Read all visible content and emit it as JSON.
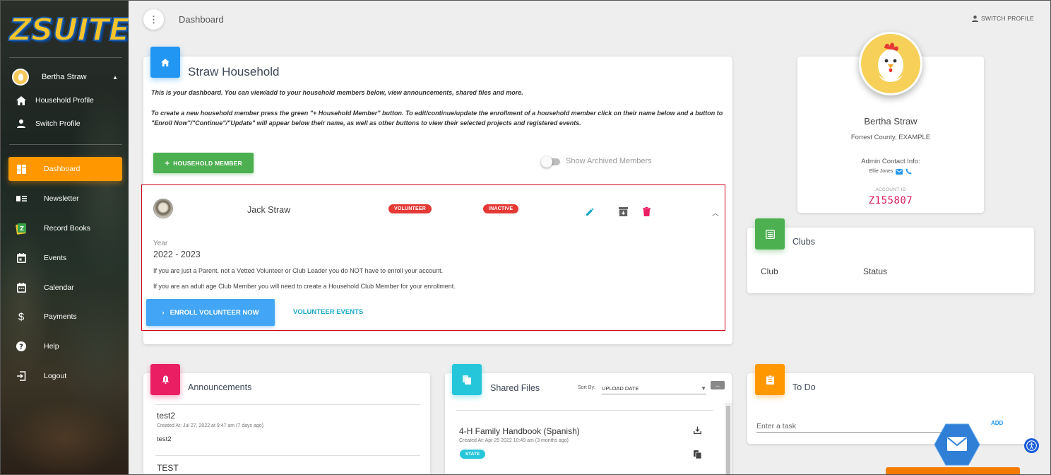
{
  "app": {
    "logo_text": "ZSUITE"
  },
  "sidebar": {
    "user_name": "Bertha Straw",
    "sub_items": [
      {
        "label": "Household Profile",
        "icon": "home-icon"
      },
      {
        "label": "Switch Profile",
        "icon": "person-icon"
      }
    ],
    "items": [
      {
        "label": "Dashboard",
        "icon": "dashboard-icon",
        "active": true
      },
      {
        "label": "Newsletter",
        "icon": "newsletter-icon"
      },
      {
        "label": "Record Books",
        "icon": "record-books-icon"
      },
      {
        "label": "Events",
        "icon": "events-icon"
      },
      {
        "label": "Calendar",
        "icon": "calendar-icon"
      },
      {
        "label": "Payments",
        "icon": "dollar-icon"
      },
      {
        "label": "Help",
        "icon": "help-icon"
      },
      {
        "label": "Logout",
        "icon": "logout-icon"
      }
    ]
  },
  "header": {
    "breadcrumb": "Dashboard",
    "switch_profile": "SWITCH PROFILE"
  },
  "household": {
    "title": "Straw Household",
    "intro1": "This is your dashboard. You can view/add to your household members below, view announcements, shared files and more.",
    "intro2": "To create a new household member press the green \"+ Household Member\" button. To edit/continue/update the enrollment of a household member click on their name below and a button to \"Enroll Now\"/\"Continue\"/\"Update\" will appear below their name, as well as other buttons to view their selected projects and registered events.",
    "add_member_label": "HOUSEHOLD MEMBER",
    "show_archived_label": "Show Archived Members",
    "member": {
      "name": "Jack Straw",
      "role_badge": "VOLUNTEER",
      "status_badge": "INACTIVE",
      "year_label": "Year",
      "year_value": "2022 - 2023",
      "note1": "If you are just a Parent, not a Vetted Volunteer or Club Leader you do NOT have to enroll your account.",
      "note2": "If you are an adult age Club Member you will need to create a Household Club Member for your enrollment.",
      "enroll_label": "ENROLL VOLUNTEER NOW",
      "events_label": "VOLUNTEER EVENTS"
    }
  },
  "profile": {
    "name": "Bertha Straw",
    "county": "Forrest County, EXAMPLE",
    "admin_label": "Admin Contact Info:",
    "admin_name": "Ellie Jones",
    "account_id_label": "ACCOUNT ID",
    "account_id": "Z155807"
  },
  "clubs": {
    "title": "Clubs",
    "col_club": "Club",
    "col_status": "Status"
  },
  "announcements": {
    "title": "Announcements",
    "items": [
      {
        "title": "test2",
        "meta": "Created At: Jul 27, 2022 at 9:47 am (7 days ago)",
        "body": "test2"
      },
      {
        "title": "TEST"
      }
    ]
  },
  "shared_files": {
    "title": "Shared Files",
    "sort_label": "Sort By:",
    "sort_value": "UPLOAD DATE",
    "files": [
      {
        "name": "4-H Family Handbook (Spanish)",
        "meta": "Created At: Apr 25 2022 10:49 am (3 months ago)",
        "badge": "STATE"
      }
    ]
  },
  "todo": {
    "title": "To Do",
    "placeholder": "Enter a task",
    "add_label": "ADD"
  },
  "colors": {
    "accent_orange": "#ff9800",
    "green": "#4caf50",
    "blue": "#2196f3",
    "pink": "#e91e63",
    "cyan": "#26c6da",
    "red": "#e53935"
  }
}
